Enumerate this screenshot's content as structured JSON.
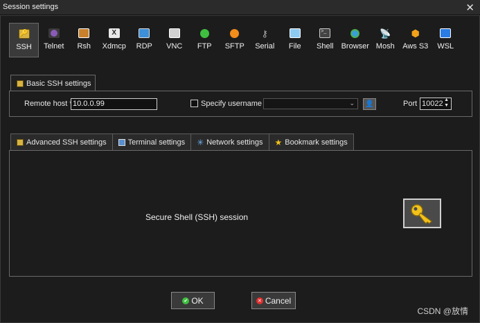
{
  "window": {
    "title": "Session settings",
    "close_glyph": "✕"
  },
  "session_types": [
    {
      "label": "SSH",
      "icon": "ssh-key-icon",
      "color": "#d9b441",
      "active": true
    },
    {
      "label": "Telnet",
      "icon": "telnet-icon",
      "color": "#8a5bb8"
    },
    {
      "label": "Rsh",
      "icon": "rsh-icon",
      "color": "#c9802b"
    },
    {
      "label": "Xdmcp",
      "icon": "xdmcp-icon",
      "color": "#e8e8e8"
    },
    {
      "label": "RDP",
      "icon": "rdp-icon",
      "color": "#3c8fd8"
    },
    {
      "label": "VNC",
      "icon": "vnc-icon",
      "color": "#d0d0d0"
    },
    {
      "label": "FTP",
      "icon": "ftp-icon",
      "color": "#3fbf3f"
    },
    {
      "label": "SFTP",
      "icon": "sftp-icon",
      "color": "#f28c1a"
    },
    {
      "label": "Serial",
      "icon": "serial-icon",
      "color": "#b0b0b0"
    },
    {
      "label": "File",
      "icon": "file-icon",
      "color": "#8ec9f0"
    },
    {
      "label": "Shell",
      "icon": "shell-icon",
      "color": "#444444"
    },
    {
      "label": "Browser",
      "icon": "browser-icon",
      "color": "#3a9fd8"
    },
    {
      "label": "Mosh",
      "icon": "mosh-icon",
      "color": "#3f7fd8"
    },
    {
      "label": "Aws S3",
      "icon": "aws-s3-icon",
      "color": "#f2a21a"
    },
    {
      "label": "WSL",
      "icon": "wsl-icon",
      "color": "#2a7be4"
    }
  ],
  "basic": {
    "tab_label": "Basic SSH settings",
    "remote_host_label": "Remote host *",
    "remote_host_value": "10.0.0.99",
    "specify_username_label": "Specify username",
    "username_value": "",
    "port_label": "Port",
    "port_value": "10022"
  },
  "advanced_tabs": [
    {
      "label": "Advanced SSH settings",
      "icon": "wrench-icon"
    },
    {
      "label": "Terminal settings",
      "icon": "terminal-icon"
    },
    {
      "label": "Network settings",
      "icon": "network-icon"
    },
    {
      "label": "Bookmark settings",
      "icon": "star-icon"
    }
  ],
  "main": {
    "description": "Secure Shell (SSH) session"
  },
  "buttons": {
    "ok_label": "OK",
    "cancel_label": "Cancel"
  },
  "watermark": "CSDN @放情"
}
